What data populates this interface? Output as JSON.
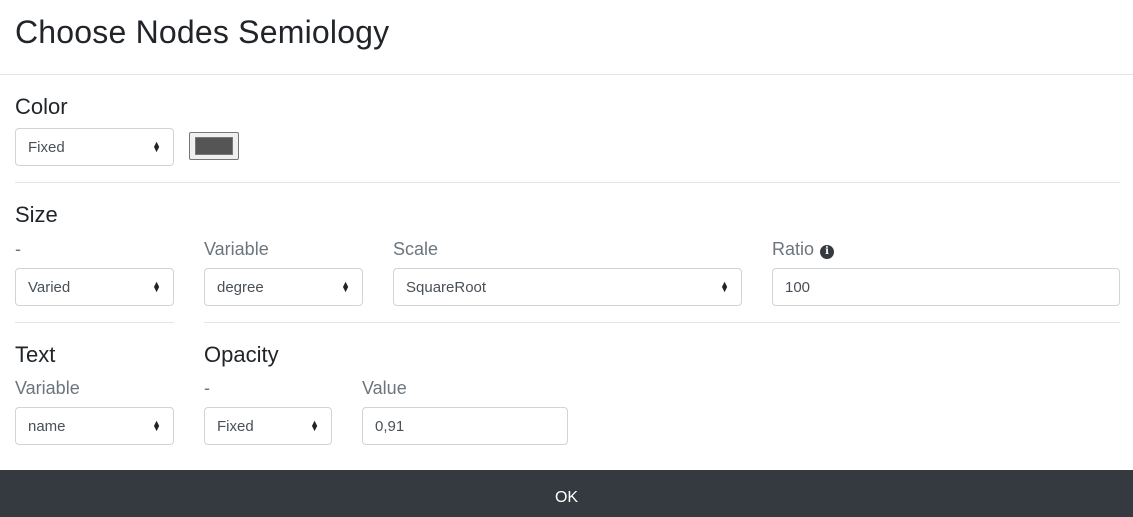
{
  "modal": {
    "title": "Choose Nodes Semiology"
  },
  "color": {
    "title": "Color",
    "mode_select": "Fixed",
    "swatch_color": "#555555"
  },
  "size": {
    "title": "Size",
    "mode_label": "-",
    "mode_select": "Varied",
    "variable_label": "Variable",
    "variable_select": "degree",
    "scale_label": "Scale",
    "scale_select": "SquareRoot",
    "ratio_label": "Ratio",
    "ratio_info_icon": "i",
    "ratio_value": "100"
  },
  "text": {
    "title": "Text",
    "variable_label": "Variable",
    "variable_select": "name"
  },
  "opacity": {
    "title": "Opacity",
    "mode_label": "-",
    "mode_select": "Fixed",
    "value_label": "Value",
    "value": "0,91"
  },
  "footer": {
    "ok_label": "OK",
    "background": "#343a40"
  }
}
